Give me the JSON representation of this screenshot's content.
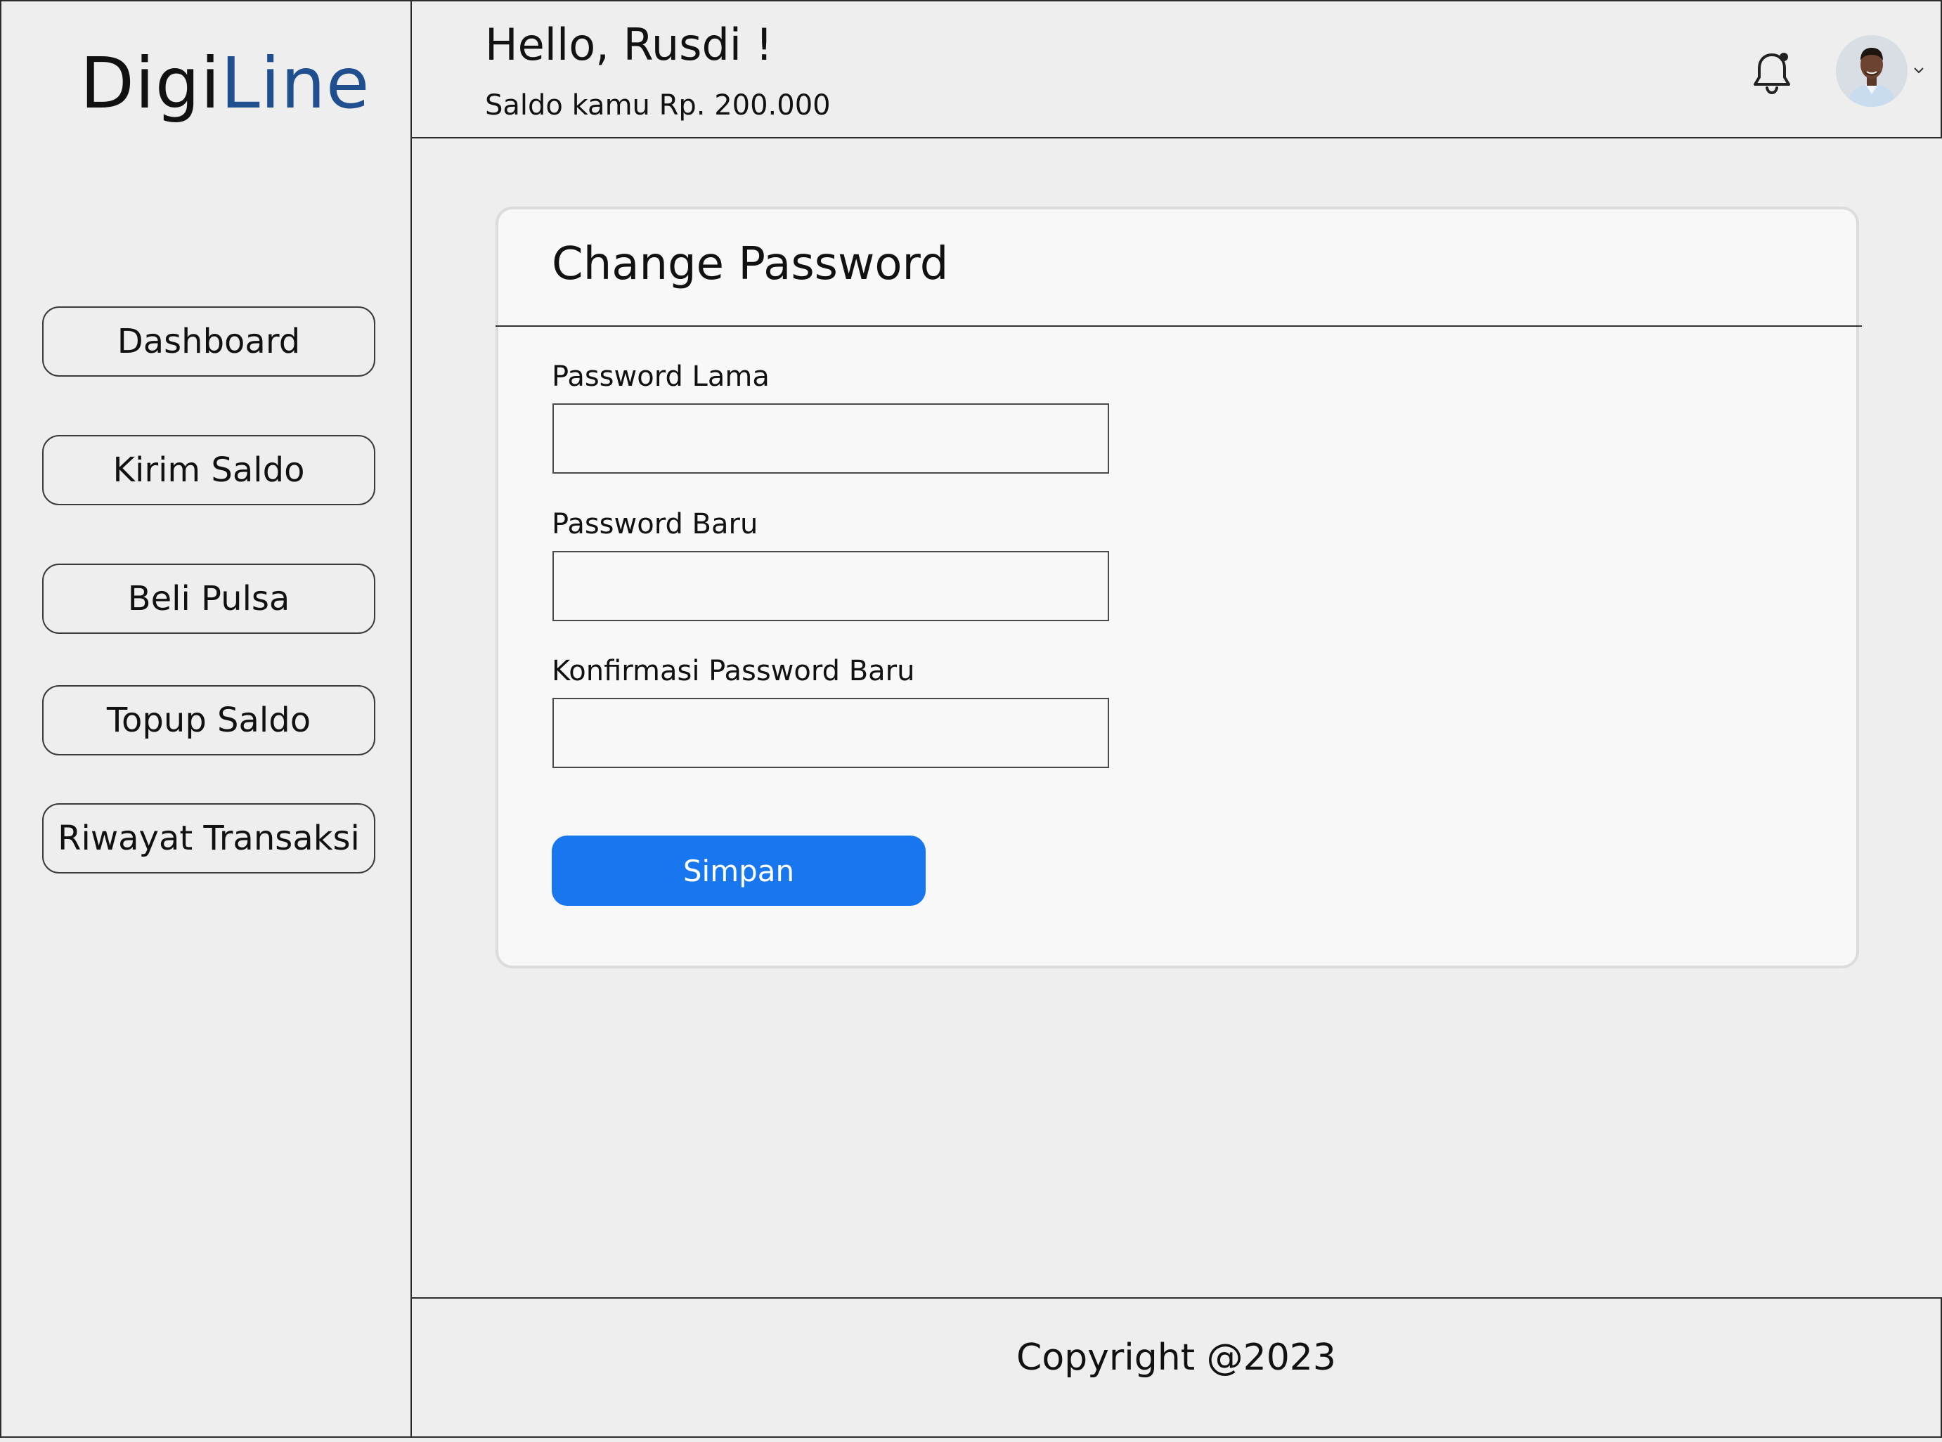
{
  "app": {
    "logo_dark": "Digi",
    "logo_blue": "Line"
  },
  "colors": {
    "background": "#eeeeee",
    "logo_accent": "#1f4f8f",
    "primary_button": "#1877ef",
    "card_background": "#f8f8f8"
  },
  "sidebar": {
    "items": [
      {
        "label": "Dashboard"
      },
      {
        "label": "Kirim Saldo"
      },
      {
        "label": "Beli Pulsa"
      },
      {
        "label": "Topup Saldo"
      },
      {
        "label": "Riwayat Transaksi"
      }
    ]
  },
  "header": {
    "greeting": "Hello, Rusdi !",
    "balance_text": "Saldo kamu Rp. 200.000",
    "icons": [
      "bell-icon",
      "avatar",
      "chevron-down-icon"
    ]
  },
  "form": {
    "title": "Change Password",
    "fields": [
      {
        "label": "Password Lama",
        "value": "",
        "placeholder": ""
      },
      {
        "label": "Password Baru",
        "value": "",
        "placeholder": ""
      },
      {
        "label": "Konfirmasi Password Baru",
        "value": "",
        "placeholder": ""
      }
    ],
    "submit_label": "Simpan"
  },
  "footer": {
    "copyright": "Copyright @2023"
  }
}
